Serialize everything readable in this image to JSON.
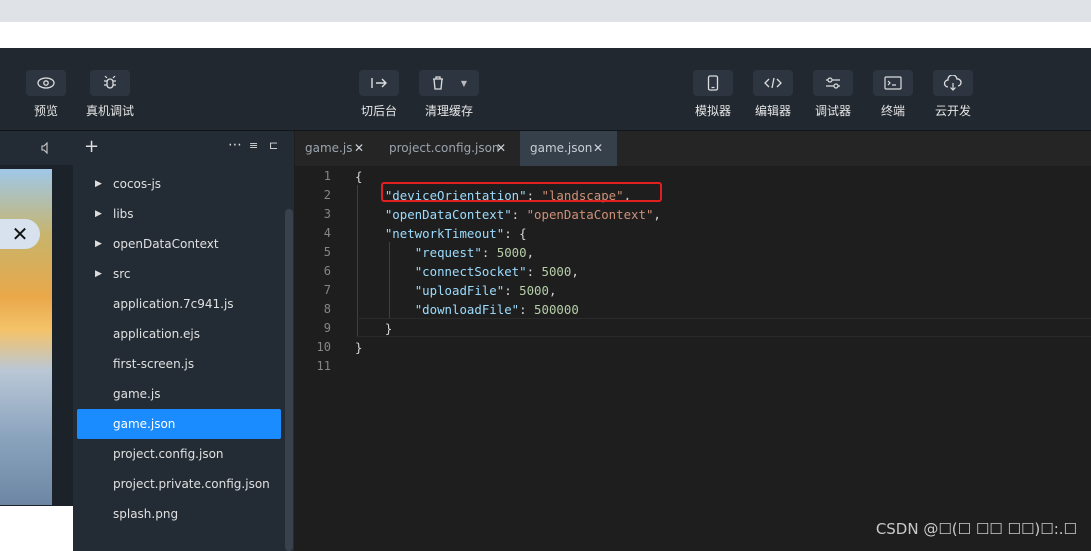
{
  "toolbar": {
    "left_buttons": [
      {
        "label": "预览",
        "icon": "eye-icon"
      },
      {
        "label": "真机调试",
        "icon": "debug-bug-icon"
      }
    ],
    "center_buttons": [
      {
        "label": "切后台",
        "icon": "switch-background-icon"
      },
      {
        "label": "清理缓存",
        "icon": "trash-icon"
      }
    ],
    "right_buttons": [
      {
        "label": "模拟器",
        "icon": "phone-icon"
      },
      {
        "label": "编辑器",
        "icon": "code-icon"
      },
      {
        "label": "调试器",
        "icon": "sliders-icon"
      },
      {
        "label": "终端",
        "icon": "terminal-icon"
      },
      {
        "label": "云开发",
        "icon": "cloud-icon"
      }
    ]
  },
  "explorer": {
    "items": [
      {
        "name": "cocos-js",
        "folder": true
      },
      {
        "name": "libs",
        "folder": true
      },
      {
        "name": "openDataContext",
        "folder": true
      },
      {
        "name": "src",
        "folder": true
      },
      {
        "name": "application.7c941.js",
        "folder": false
      },
      {
        "name": "application.ejs",
        "folder": false
      },
      {
        "name": "first-screen.js",
        "folder": false
      },
      {
        "name": "game.js",
        "folder": false
      },
      {
        "name": "game.json",
        "folder": false,
        "selected": true
      },
      {
        "name": "project.config.json",
        "folder": false
      },
      {
        "name": "project.private.config.json",
        "folder": false
      },
      {
        "name": "splash.png",
        "folder": false
      }
    ]
  },
  "editor": {
    "tabs": [
      {
        "label": "game.js",
        "close": "✕"
      },
      {
        "label": "project.config.json",
        "close": "✕"
      },
      {
        "label": "game.json",
        "close": "✕",
        "active": true
      }
    ],
    "line_numbers": [
      "1",
      "2",
      "3",
      "4",
      "5",
      "6",
      "7",
      "8",
      "9",
      "10",
      "11"
    ],
    "lines": [
      [
        {
          "t": "{",
          "c": "p"
        }
      ],
      [
        {
          "t": "    "
        },
        {
          "t": "\"deviceOrientation\"",
          "c": "k"
        },
        {
          "t": ": "
        },
        {
          "t": "\"landscape\"",
          "c": "s"
        },
        {
          "t": ","
        }
      ],
      [
        {
          "t": "    "
        },
        {
          "t": "\"openDataContext\"",
          "c": "k"
        },
        {
          "t": ": "
        },
        {
          "t": "\"openDataContext\"",
          "c": "s"
        },
        {
          "t": ","
        }
      ],
      [
        {
          "t": "    "
        },
        {
          "t": "\"networkTimeout\"",
          "c": "k"
        },
        {
          "t": ": {"
        }
      ],
      [
        {
          "t": "        "
        },
        {
          "t": "\"request\"",
          "c": "k"
        },
        {
          "t": ": "
        },
        {
          "t": "5000",
          "c": "n"
        },
        {
          "t": ","
        }
      ],
      [
        {
          "t": "        "
        },
        {
          "t": "\"connectSocket\"",
          "c": "k"
        },
        {
          "t": ": "
        },
        {
          "t": "5000",
          "c": "n"
        },
        {
          "t": ","
        }
      ],
      [
        {
          "t": "        "
        },
        {
          "t": "\"uploadFile\"",
          "c": "k"
        },
        {
          "t": ": "
        },
        {
          "t": "5000",
          "c": "n"
        },
        {
          "t": ","
        }
      ],
      [
        {
          "t": "        "
        },
        {
          "t": "\"downloadFile\"",
          "c": "k"
        },
        {
          "t": ": "
        },
        {
          "t": "500000",
          "c": "n"
        }
      ],
      [
        {
          "t": "    }"
        }
      ],
      [
        {
          "t": "}"
        }
      ],
      [
        {
          "t": ""
        }
      ]
    ]
  },
  "watermark": "CSDN @☐(☐ ☐☐ ☐☐)☐:.☐",
  "colors": {
    "accent": "#1a8cff",
    "highlight_box": "#e02020",
    "json_key": "#9cdcfe",
    "json_string": "#ce9178",
    "json_number": "#b5cea8"
  }
}
